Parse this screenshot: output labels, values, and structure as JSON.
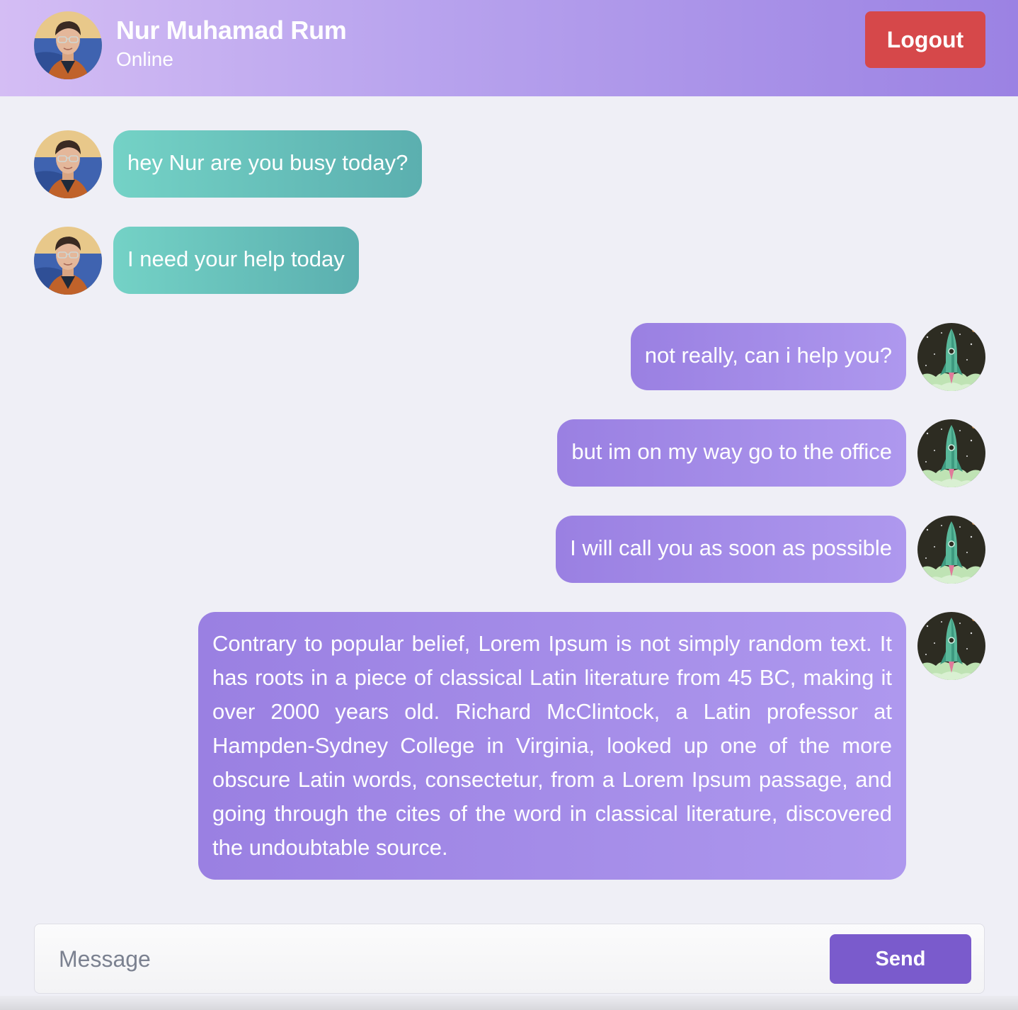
{
  "header": {
    "contact_name": "Nur Muhamad Rum",
    "status": "Online",
    "logout_label": "Logout"
  },
  "messages": [
    {
      "direction": "incoming",
      "text": "hey Nur are you busy today?"
    },
    {
      "direction": "incoming",
      "text": "I need your help today"
    },
    {
      "direction": "outgoing",
      "text": "not really, can i help you?"
    },
    {
      "direction": "outgoing",
      "text": "but im on my way go to the office"
    },
    {
      "direction": "outgoing",
      "text": "I will call you as soon as possible"
    },
    {
      "direction": "outgoing",
      "text": "Contrary to popular belief, Lorem Ipsum is not simply random text. It has roots in a piece of classical Latin literature from 45 BC, making it over 2000 years old. Richard McClintock, a Latin professor at Hampden-Sydney College in Virginia, looked up one of the more obscure Latin words, consectetur, from a Lorem Ipsum passage, and going through the cites of the word in classical literature, discovered the undoubtable source."
    }
  ],
  "composer": {
    "placeholder": "Message",
    "value": "",
    "send_label": "Send"
  },
  "colors": {
    "incoming_bubble": "#6cc4bb",
    "outgoing_bubble": "#a08aea",
    "logout": "#d6484a",
    "send": "#7a5bcc"
  }
}
